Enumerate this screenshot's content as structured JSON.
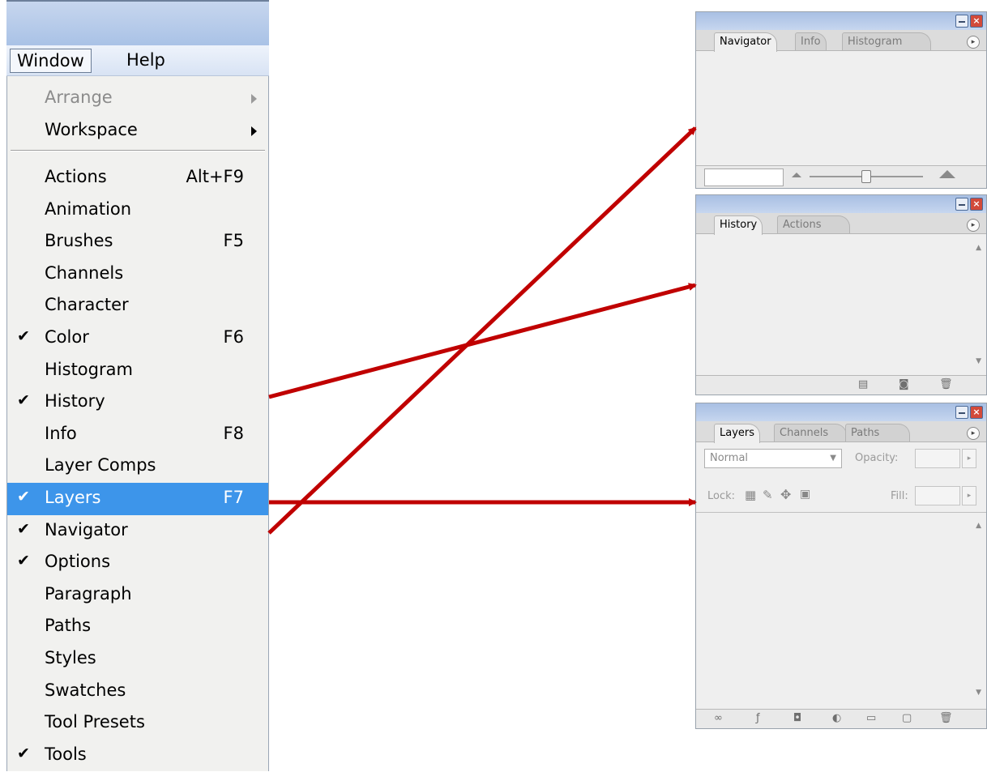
{
  "menubar": {
    "window_label": "Window",
    "help_label": "Help"
  },
  "menu": {
    "items": [
      {
        "label": "Arrange",
        "shortcut": "",
        "checked": false,
        "submenu": true,
        "disabled": true
      },
      {
        "label": "Workspace",
        "shortcut": "",
        "checked": false,
        "submenu": true,
        "disabled": false
      },
      {
        "label": "Actions",
        "shortcut": "Alt+F9",
        "checked": false
      },
      {
        "label": "Animation",
        "shortcut": "",
        "checked": false
      },
      {
        "label": "Brushes",
        "shortcut": "F5",
        "checked": false
      },
      {
        "label": "Channels",
        "shortcut": "",
        "checked": false
      },
      {
        "label": "Character",
        "shortcut": "",
        "checked": false
      },
      {
        "label": "Color",
        "shortcut": "F6",
        "checked": true
      },
      {
        "label": "Histogram",
        "shortcut": "",
        "checked": false
      },
      {
        "label": "History",
        "shortcut": "",
        "checked": true
      },
      {
        "label": "Info",
        "shortcut": "F8",
        "checked": false
      },
      {
        "label": "Layer Comps",
        "shortcut": "",
        "checked": false
      },
      {
        "label": "Layers",
        "shortcut": "F7",
        "checked": true,
        "highlighted": true
      },
      {
        "label": "Navigator",
        "shortcut": "",
        "checked": true
      },
      {
        "label": "Options",
        "shortcut": "",
        "checked": true
      },
      {
        "label": "Paragraph",
        "shortcut": "",
        "checked": false
      },
      {
        "label": "Paths",
        "shortcut": "",
        "checked": false
      },
      {
        "label": "Styles",
        "shortcut": "",
        "checked": false
      },
      {
        "label": "Swatches",
        "shortcut": "",
        "checked": false
      },
      {
        "label": "Tool Presets",
        "shortcut": "",
        "checked": false
      },
      {
        "label": "Tools",
        "shortcut": "",
        "checked": true
      }
    ],
    "check_glyph": "✔"
  },
  "navigator_palette": {
    "tabs": [
      "Navigator",
      "Info",
      "Histogram"
    ]
  },
  "history_palette": {
    "tabs": [
      "History",
      "Actions"
    ]
  },
  "layers_palette": {
    "tabs": [
      "Layers",
      "Channels",
      "Paths"
    ],
    "blend_mode": "Normal",
    "opacity_label": "Opacity:",
    "lock_label": "Lock:",
    "fill_label": "Fill:"
  },
  "colors": {
    "arrow": "#c00000",
    "highlight": "#3d95ea"
  }
}
